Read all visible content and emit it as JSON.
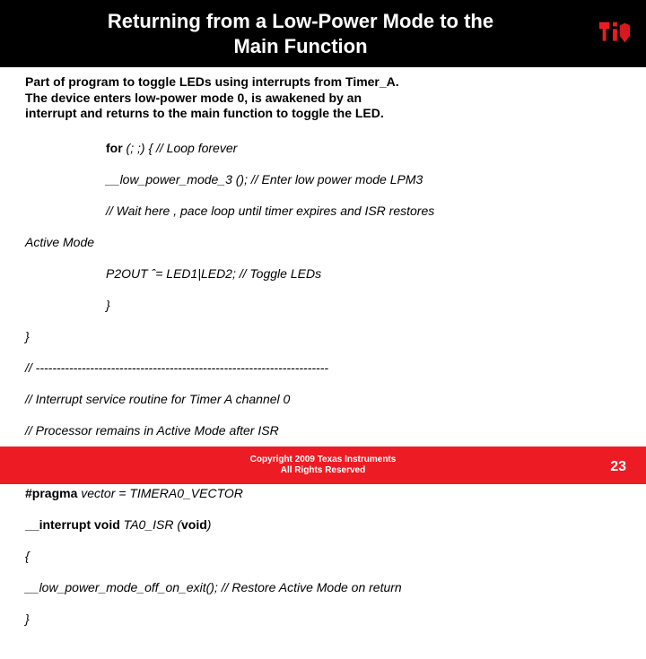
{
  "header": {
    "title_line1": "Returning from a Low-Power Mode to the",
    "title_line2": "Main Function"
  },
  "intro": {
    "l1": "Part of program to toggle LEDs using interrupts from Timer_A.",
    "l2": "The device enters low-power mode 0, is awakened by an",
    "l3": "interrupt and returns to the main function to toggle the LED."
  },
  "code": {
    "l1_kw": "for",
    "l1_rest": " (; ;) { // Loop forever",
    "l2": "__low_power_mode_3 (); // Enter low power mode LPM3",
    "l3": "// Wait here , pace loop until timer expires and ISR restores",
    "l3b": "Active Mode",
    "l4": "P2OUT ˆ= LED1|LED2; // Toggle LEDs",
    "l5": "}",
    "l6": "}",
    "l7": "// ----------------------------------------------------------------------",
    "l8": "// Interrupt service routine for Timer A channel 0",
    "l9": "// Processor remains in Active Mode after ISR",
    "l10": "// ----------------------------------------------------------------------",
    "l11a": "#pragma",
    "l11b": " vector = TIMERA0_VECTOR",
    "l12a": "__interrupt void",
    "l12b": " TA0_ISR (",
    "l12c": "void",
    "l12d": ")",
    "l13": "{",
    "l14": "__low_power_mode_off_on_exit(); // Restore Active Mode on return",
    "l15": "}"
  },
  "footer": {
    "line1": "Copyright  2009 Texas Instruments",
    "line2": "All Rights Reserved"
  },
  "page_number": "23"
}
